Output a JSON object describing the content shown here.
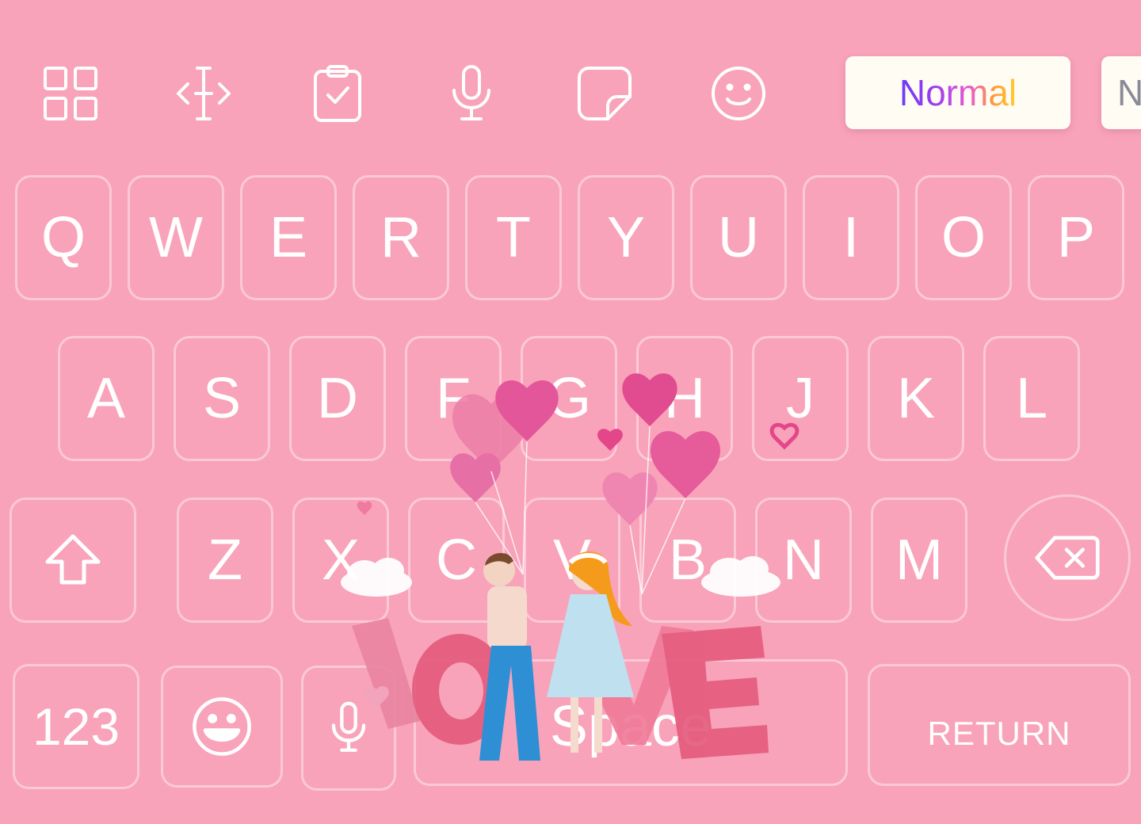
{
  "toolbar": {
    "icons": [
      "apps-grid-icon",
      "text-cursor-icon",
      "clipboard-icon",
      "microphone-icon",
      "sticker-icon",
      "smiley-icon"
    ],
    "font_chips": [
      "Normal",
      "N"
    ]
  },
  "keyboard": {
    "row1": [
      "Q",
      "W",
      "E",
      "R",
      "T",
      "Y",
      "U",
      "I",
      "O",
      "P"
    ],
    "row2": [
      "A",
      "S",
      "D",
      "F",
      "G",
      "H",
      "J",
      "K",
      "L"
    ],
    "row3": [
      "Z",
      "X",
      "C",
      "V",
      "B",
      "N",
      "M"
    ],
    "bottom": {
      "numbers": "123",
      "space": "Space",
      "return": "RETURN"
    }
  },
  "theme": {
    "background": "#f8a3ba",
    "key_border": "rgba(255,255,255,0.42)",
    "text": "#ffffff"
  },
  "decoration": {
    "name": "love-couple-balloons-illustration",
    "text_in_art": "LOVE"
  }
}
